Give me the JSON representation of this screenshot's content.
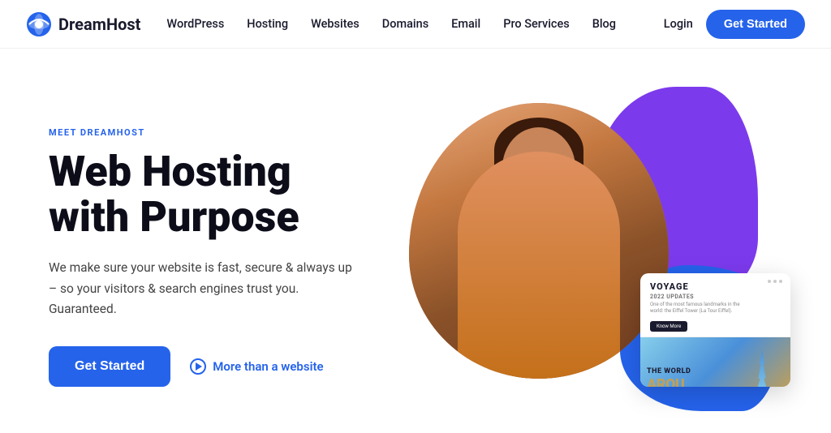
{
  "navbar": {
    "logo_text": "DreamHost",
    "links": [
      {
        "label": "WordPress",
        "id": "wordpress"
      },
      {
        "label": "Hosting",
        "id": "hosting"
      },
      {
        "label": "Websites",
        "id": "websites"
      },
      {
        "label": "Domains",
        "id": "domains"
      },
      {
        "label": "Email",
        "id": "email"
      },
      {
        "label": "Pro Services",
        "id": "pro-services"
      },
      {
        "label": "Blog",
        "id": "blog"
      }
    ],
    "login_label": "Login",
    "get_started_label": "Get Started"
  },
  "hero": {
    "meet_label": "MEET DREAMHOST",
    "title_line1": "Web Hosting",
    "title_line2": "with Purpose",
    "description": "We make sure your website is fast, secure & always up – so your visitors & search engines trust you. Guaranteed.",
    "cta_label": "Get Started",
    "more_link_label": "More than a website"
  },
  "card": {
    "title": "VOYAGE",
    "subtitle": "2022 UPDATES",
    "desc_line1": "One of the most famous landmarks in the",
    "desc_line2": "world: the Eiffel Tower (La Tour Eiffel).",
    "btn_label": "Know More",
    "world_text": "THE WORLD",
    "big_text": "AROU"
  },
  "colors": {
    "blue": "#2563eb",
    "purple": "#7c3aed",
    "dark": "#0d0d1a"
  }
}
